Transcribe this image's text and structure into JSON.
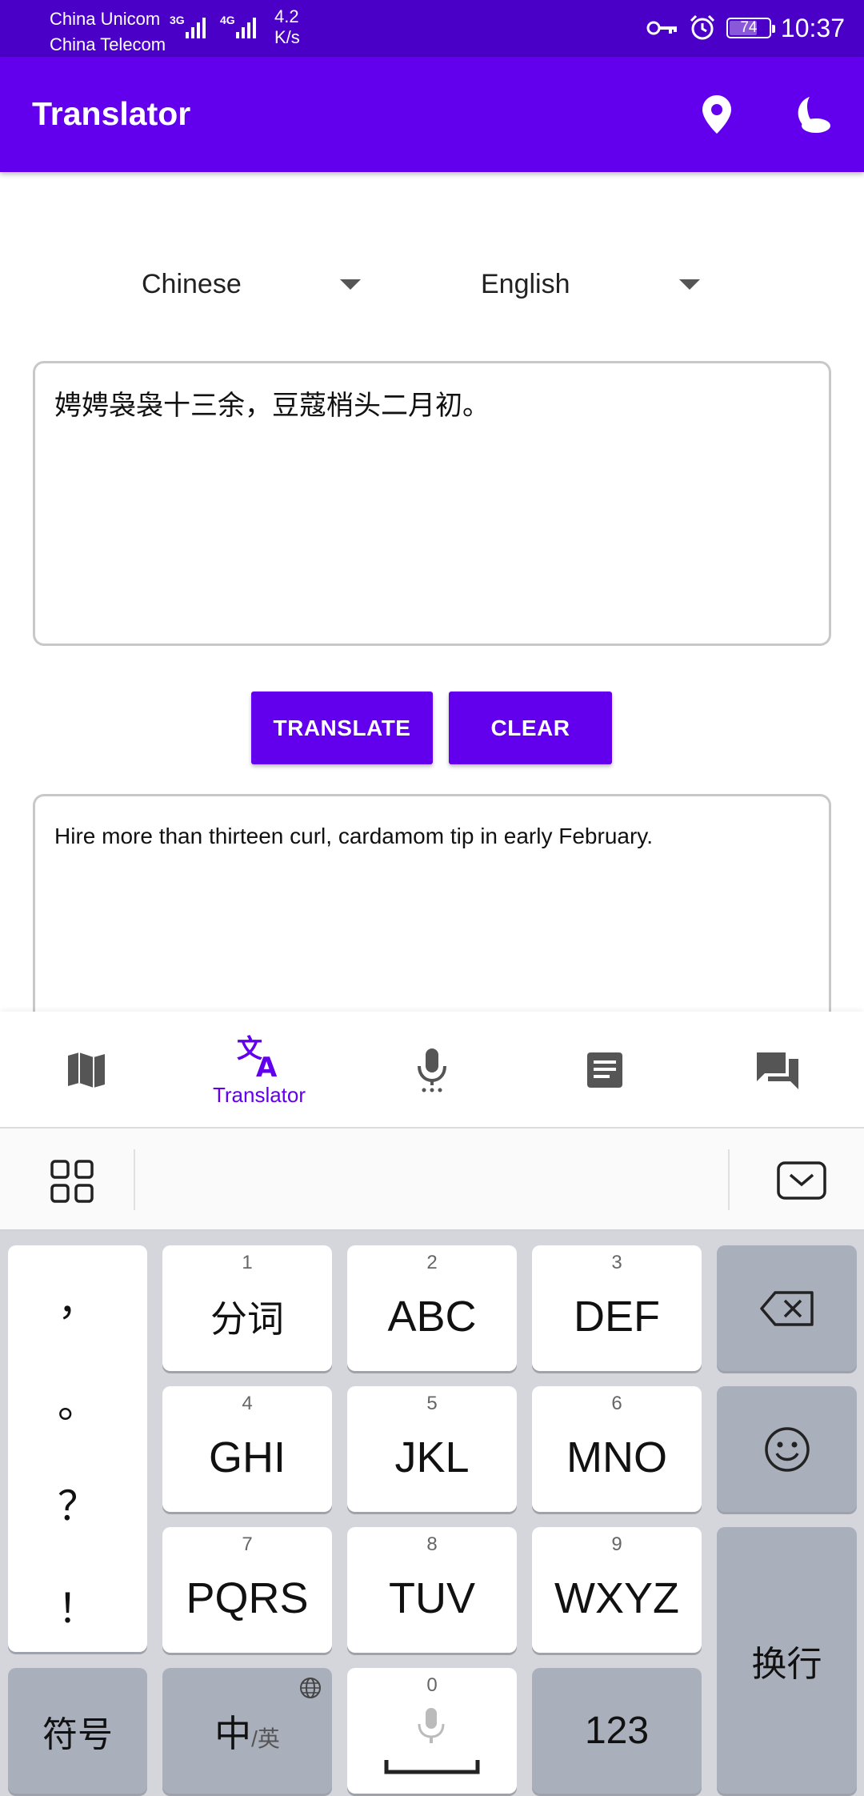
{
  "status_bar": {
    "carrier_1": "China Unicom",
    "carrier_2": "China Telecom",
    "net_1": "3G",
    "net_2": "4G",
    "speed_value": "4.2",
    "speed_unit": "K/s",
    "battery": "74",
    "battery_level": 0.74,
    "time": "10:37",
    "icons": [
      "key-icon",
      "alarm-icon",
      "battery-icon"
    ]
  },
  "app_bar": {
    "title": "Translator",
    "actions": [
      "location-pin-icon",
      "night-mode-icon"
    ]
  },
  "languages": {
    "source": "Chinese",
    "target": "English"
  },
  "source_text": "娉娉袅袅十三余，豆蔻梢头二月初。",
  "buttons": {
    "translate": "TRANSLATE",
    "clear": "CLEAR"
  },
  "result_text": "Hire more than thirteen curl, cardamom tip in early February.",
  "bottom_nav": {
    "items": [
      {
        "icon": "map-icon",
        "label": ""
      },
      {
        "icon": "translate-icon",
        "label": "Translator",
        "selected": true
      },
      {
        "icon": "microphone-icon",
        "label": ""
      },
      {
        "icon": "document-icon",
        "label": ""
      },
      {
        "icon": "chat-icon",
        "label": ""
      }
    ]
  },
  "keyboard": {
    "toolbar_icons": [
      "grid-menu-icon",
      "collapse-keyboard-icon"
    ],
    "punctuation": [
      "，",
      "。",
      "？",
      "！"
    ],
    "keys": [
      {
        "num": "1",
        "label": "分词"
      },
      {
        "num": "2",
        "label": "ABC"
      },
      {
        "num": "3",
        "label": "DEF"
      },
      {
        "num": "4",
        "label": "GHI"
      },
      {
        "num": "5",
        "label": "JKL"
      },
      {
        "num": "6",
        "label": "MNO"
      },
      {
        "num": "7",
        "label": "PQRS"
      },
      {
        "num": "8",
        "label": "TUV"
      },
      {
        "num": "9",
        "label": "WXYZ"
      }
    ],
    "symbols": "符号",
    "lang_switch_main": "中",
    "lang_switch_sub": "/英",
    "space_num": "0",
    "numbers": "123",
    "enter": "换行"
  }
}
